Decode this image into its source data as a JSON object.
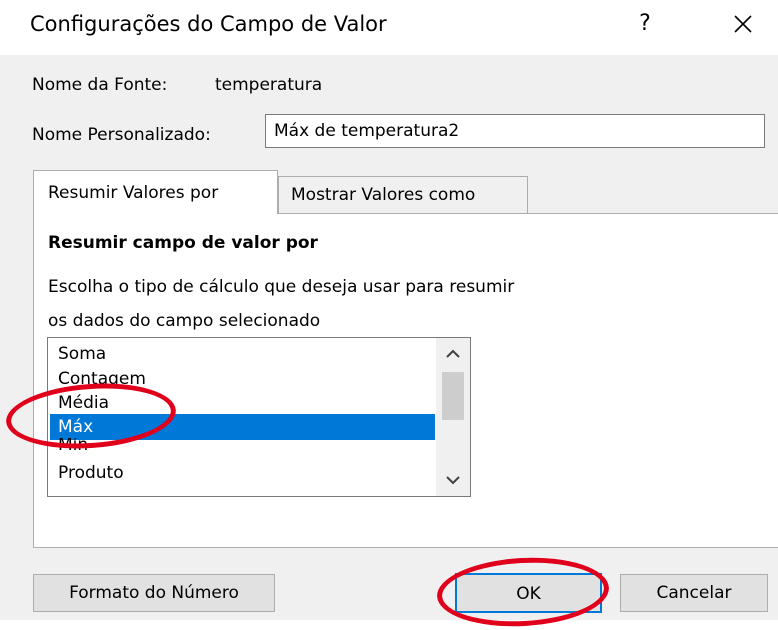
{
  "window": {
    "title": "Configurações do Campo de Valor",
    "help_label": "?"
  },
  "source": {
    "label": "Nome da Fonte:",
    "value": "temperatura"
  },
  "custom_name": {
    "label": "Nome Personalizado:",
    "value": "Máx de temperatura2"
  },
  "tabs": [
    {
      "label": "Resumir Valores por",
      "active": true
    },
    {
      "label": "Mostrar Valores como",
      "active": false
    }
  ],
  "summarize": {
    "section_title": "Resumir campo de valor por",
    "description_line1": "Escolha o tipo de cálculo que deseja usar para resumir",
    "description_line2": "os dados do campo selecionado",
    "items": [
      "Soma",
      "Contagem",
      "Média",
      "Máx",
      "Mín",
      "Produto"
    ],
    "selected": "Máx"
  },
  "buttons": {
    "number_format": "Formato do Número",
    "ok": "OK",
    "cancel": "Cancelar"
  },
  "colors": {
    "selection": "#0078d7",
    "annotation": "#e0001b",
    "dialog_bg": "#f0f0f0"
  },
  "icons": {
    "close": "close-icon",
    "scroll_up": "chevron-up-icon",
    "scroll_down": "chevron-down-icon"
  }
}
